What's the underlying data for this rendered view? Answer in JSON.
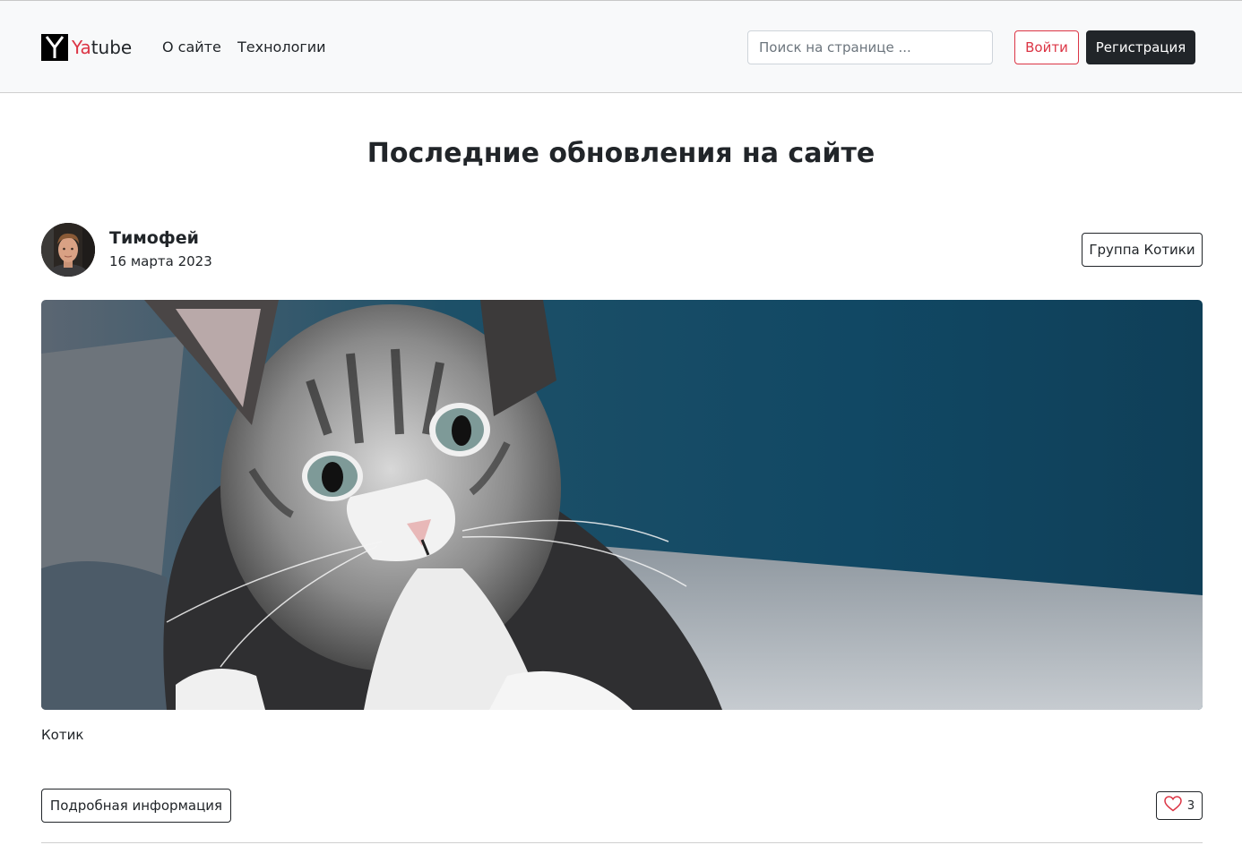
{
  "header": {
    "brand": {
      "prefix": "Ya",
      "suffix": "tube",
      "logo_letter": "Y"
    },
    "nav": [
      {
        "label": "О сайте"
      },
      {
        "label": "Технологии"
      }
    ],
    "search": {
      "placeholder": "Поиск на странице ...",
      "value": ""
    },
    "login_label": "Войти",
    "register_label": "Регистрация"
  },
  "main": {
    "title": "Последние обновления на сайте",
    "post": {
      "author": "Тимофей",
      "date": "16 марта 2023",
      "group_label": "Группа Котики",
      "image_icon": "kitten-photo",
      "text": "Котик",
      "details_label": "Подробная информация",
      "likes": "3"
    }
  },
  "colors": {
    "accent": "#dc3545",
    "dark": "#212529",
    "navbar_bg": "#f8f9fa"
  }
}
